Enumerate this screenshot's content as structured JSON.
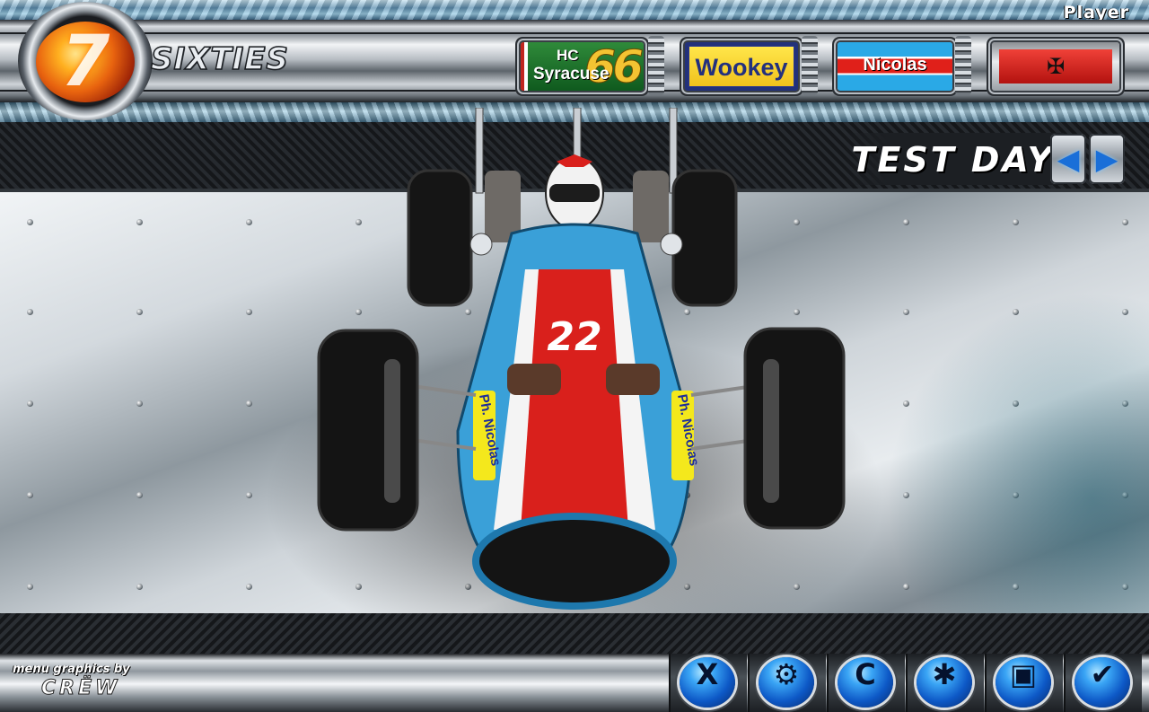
{
  "header": {
    "player_label": "Player",
    "logo_text": "SIXTIES",
    "logo_numeral": "7",
    "team": {
      "line1": "HC",
      "line2": "Syracuse",
      "number": "66"
    },
    "car_name": "Wookey",
    "driver_name": "Nicolas",
    "flag_icon": "albania-flag-icon"
  },
  "session": {
    "title": "TEST DAY",
    "prev_icon": "◀",
    "next_icon": "▶"
  },
  "car": {
    "number": "22",
    "sponsor_left": "Ph. Nicolas",
    "sponsor_right": "Ph. Nicolas",
    "colors": {
      "body": "#3aa0d8",
      "stripe": "#d9201c",
      "white": "#f4f4f4",
      "sponsor": "#f4e81c"
    }
  },
  "footer": {
    "credit_line1": "menu graphics by",
    "credit_line2": "CRËW",
    "buttons": [
      {
        "icon": "close-icon",
        "glyph": "X"
      },
      {
        "icon": "car-setup-icon",
        "glyph": "⚙"
      },
      {
        "icon": "garage-icon",
        "glyph": "C"
      },
      {
        "icon": "engine-icon",
        "glyph": "✱"
      },
      {
        "icon": "camera-icon",
        "glyph": "▣"
      },
      {
        "icon": "check-icon",
        "glyph": "✔"
      }
    ]
  }
}
